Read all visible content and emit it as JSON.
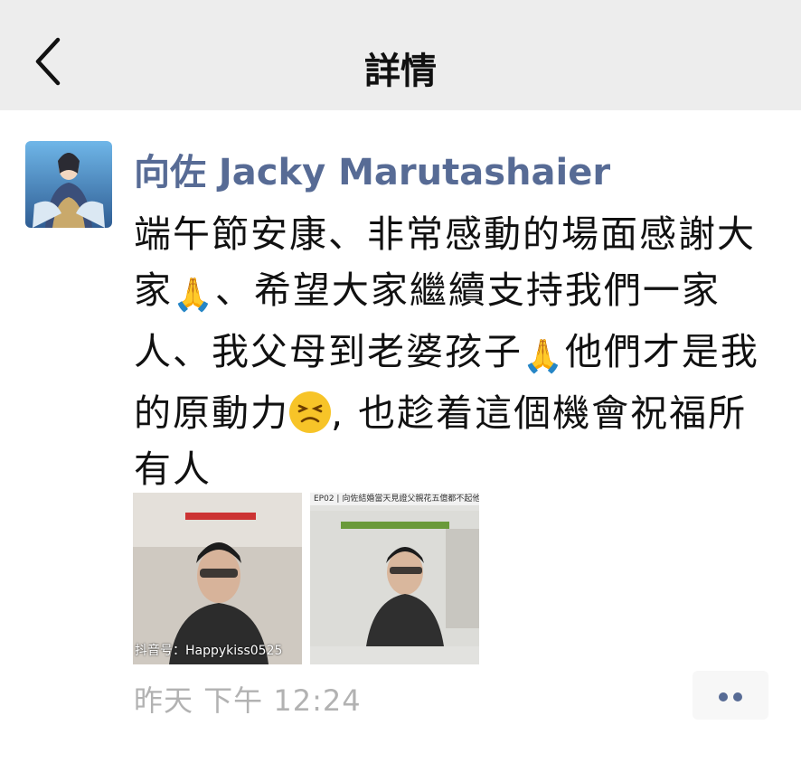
{
  "navbar": {
    "title": "詳情",
    "back_icon": "chevron-left-icon"
  },
  "post": {
    "author": "向佐 Jacky Marutashaier",
    "text_parts": [
      "端午節安康、非常感動的場面感謝大家",
      "、希望大家繼續支持我們一家人、我父母到老婆孩子",
      "他們才是我的原動力",
      ", 也趁着這個機會祝福所有人"
    ],
    "emoji": {
      "pray": "🙏",
      "face": "persevering-face-emoji"
    },
    "images": [
      {
        "caption": "",
        "watermark": "抖音号：Happykiss0525"
      },
      {
        "caption": "EP02 | 向佐結婚當天見證父親花五億都不起他",
        "watermark": ""
      }
    ],
    "timestamp": "昨天 下午 12:24"
  },
  "colors": {
    "author": "#576b95",
    "navbar_bg": "#ededed",
    "timestamp": "#b2b2b2"
  }
}
